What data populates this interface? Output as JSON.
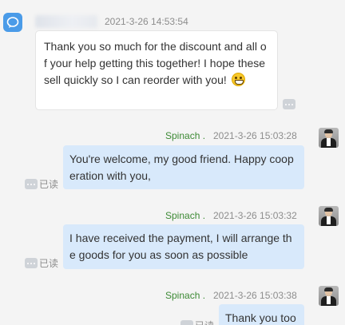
{
  "incoming": {
    "time": "2021-3-26 14:53:54",
    "text": "Thank you so much for the discount and all of your help getting this together! I hope these sell quickly so I can reorder with you!",
    "emoji": "grinning-face-emoji"
  },
  "outgoing": [
    {
      "sender": "Spinach .",
      "time": "2021-3-26 15:03:28",
      "text": "You're welcome, my good friend. Happy cooperation with you,",
      "status": "已读"
    },
    {
      "sender": "Spinach .",
      "time": "2021-3-26 15:03:32",
      "text": "I have received the payment, I will arrange the goods for you as soon as possible",
      "status": "已读"
    },
    {
      "sender": "Spinach .",
      "time": "2021-3-26 15:03:38",
      "text": "Thank you too",
      "status": "已读"
    }
  ],
  "colors": {
    "background": "#f4f4f4",
    "incoming_bubble": "#ffffff",
    "outgoing_bubble": "#d8e9fb",
    "sender_name": "#3d8a35",
    "timestamp": "#8d8d8d"
  }
}
